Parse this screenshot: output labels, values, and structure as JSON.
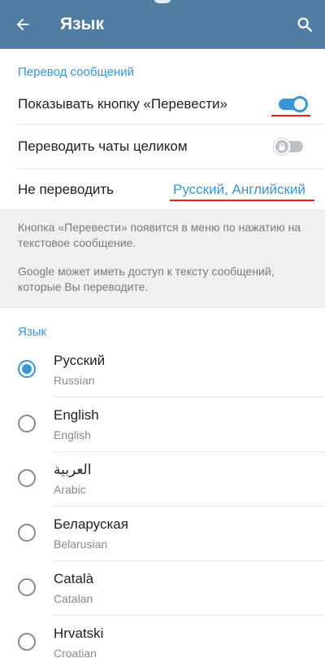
{
  "appbar": {
    "title": "Язык",
    "back_icon": "arrow-left-icon",
    "search_icon": "search-icon",
    "color": "#517da2"
  },
  "translation": {
    "header": "Перевод сообщений",
    "show_button_label": "Показывать кнопку «Перевести»",
    "show_button_enabled": true,
    "translate_chats_label": "Переводить чаты целиком",
    "translate_chats_enabled": false,
    "translate_chats_locked": true,
    "do_not_translate_label": "Не переводить",
    "do_not_translate_value": "Русский, Английский"
  },
  "info": {
    "paragraph1": "Кнопка «Перевести» появится в меню по нажатию на текстовое сообщение.",
    "paragraph2": "Google может иметь доступ к тексту сообщений, которые Вы переводите."
  },
  "language": {
    "header": "Язык",
    "items": [
      {
        "name": "Русский",
        "sub": "Russian",
        "selected": true
      },
      {
        "name": "English",
        "sub": "English",
        "selected": false
      },
      {
        "name": "العربية",
        "sub": "Arabic",
        "selected": false
      },
      {
        "name": "Беларуская",
        "sub": "Belarusian",
        "selected": false
      },
      {
        "name": "Català",
        "sub": "Catalan",
        "selected": false
      },
      {
        "name": "Hrvatski",
        "sub": "Croatian",
        "selected": false
      }
    ]
  },
  "colors": {
    "accent": "#3a95d5",
    "annotation": "#ff1a1a"
  }
}
